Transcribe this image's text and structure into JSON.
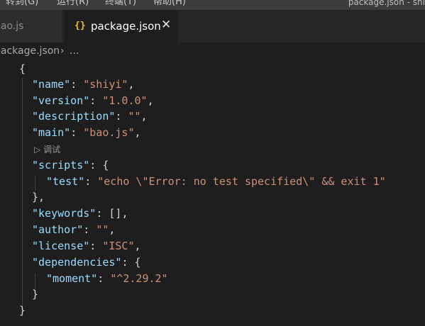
{
  "menu": {
    "goto_label": "转到(G)",
    "run_label": "运行(R)",
    "terminal_label": "终端(T)",
    "help_label": "帮助(H)",
    "window_title": "package.json - shi"
  },
  "tabs": [
    {
      "label": "bao.js",
      "active": false
    },
    {
      "label": "package.json",
      "active": true,
      "icon": "{}",
      "close": "✕"
    }
  ],
  "breadcrumb": {
    "file": "package.json",
    "separator": "›",
    "more": "..."
  },
  "codelens": {
    "icon": "▷",
    "label": "调试"
  },
  "colors": {
    "key": "#9cdcfe",
    "string": "#ce9178",
    "punct": "#d4d4d4",
    "background": "#1e1e1e"
  },
  "code": {
    "open_brace": "{",
    "name_key": "\"name\"",
    "name_val": "\"shiyi\"",
    "version_key": "\"version\"",
    "version_val": "\"1.0.0\"",
    "description_key": "\"description\"",
    "description_val": "\"\"",
    "main_key": "\"main\"",
    "main_val": "\"bao.js\"",
    "scripts_key": "\"scripts\"",
    "test_key": "\"test\"",
    "test_val": "\"echo \\\"Error: no test specified\\\" && exit 1\"",
    "scripts_close": "},",
    "keywords_key": "\"keywords\"",
    "keywords_val": "[]",
    "author_key": "\"author\"",
    "author_val": "\"\"",
    "license_key": "\"license\"",
    "license_val": "\"ISC\"",
    "dependencies_key": "\"dependencies\"",
    "moment_key": "\"moment\"",
    "moment_val": "\"^2.29.2\"",
    "dependencies_close": "}",
    "close_brace": "}"
  }
}
